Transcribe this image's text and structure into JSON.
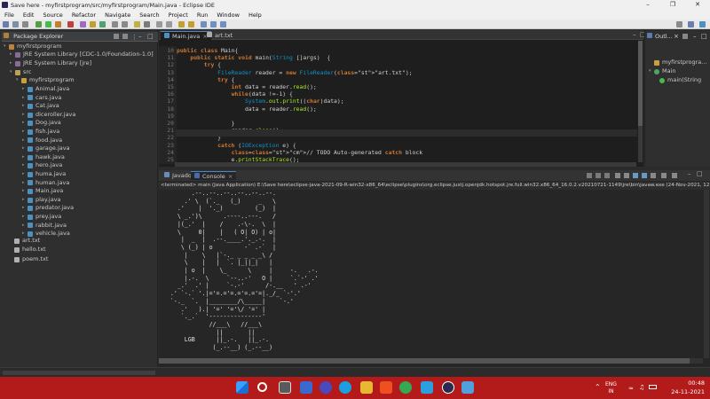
{
  "window": {
    "title": "Save here - myfirstprogram/src/myfirstprogram/Main.java - Eclipse IDE"
  },
  "menu": [
    "File",
    "Edit",
    "Source",
    "Refactor",
    "Navigate",
    "Search",
    "Project",
    "Run",
    "Window",
    "Help"
  ],
  "package_explorer": {
    "tab_label": "Package Explorer",
    "project": "myfirstprogram",
    "libs": [
      "JRE System Library [CDC-1.0/Foundation-1.0]",
      "JRE System Library [jre]"
    ],
    "src": "src",
    "package": "myfirstprogram",
    "files": [
      "Animal.java",
      "cars.java",
      "Cat.java",
      "diceroller.java",
      "Dog.java",
      "fish.java",
      "food.java",
      "garage.java",
      "hawk.java",
      "hero.java",
      "huma.java",
      "human.java",
      "Main.java",
      "play.java",
      "predator.java",
      "prey.java",
      "rabbit.java",
      "vehicle.java"
    ],
    "root_files": [
      "art.txt",
      "hello.txt",
      "poem.txt"
    ]
  },
  "editor": {
    "tabs": [
      "Main.java",
      "art.txt"
    ],
    "line_numbers": [
      "10",
      "11",
      "12",
      "13",
      "14",
      "15",
      "16",
      "17",
      "18",
      "19",
      "20",
      "21",
      "22",
      "23",
      "24",
      "25"
    ],
    "lines": [
      "public class Main{",
      "    public static void main(String []args)  {",
      "        try {",
      "            FileReader reader = new FileReader(\"art.txt\");",
      "            try {",
      "                int data = reader.read();",
      "                while(data !=-1) {",
      "                    System.out.print((char)data);",
      "                    data = reader.read();",
      "",
      "                }",
      "                reader.close();",
      "            }",
      "            catch (IOException e) {",
      "                // TODO Auto-generated catch block",
      "                e.printStackTrace();"
    ]
  },
  "outline": {
    "tab_label": "Outl...",
    "items": [
      "myfirstprogra...",
      "Main",
      "main(String"
    ]
  },
  "console": {
    "tabs": [
      "Javadoc",
      "Console"
    ],
    "terminated": "<terminated> main (Java Application) E:\\Save here\\eclipse-java-2021-09-R-win32-x86_64\\eclipse\\plugins\\org.eclipse.justj.openjdk.hotspot.jre.full.win32.x86_64_16.0.2.v20210721-1149\\jre\\bin\\javaw.exe  (24-Nov-2021, 12:",
    "ascii_art": [
      "         .--..--..--..--..--..--.",
      "       .' \\  (`._   (_)     _   \\",
      "     .'    |  '._)         (_)  |",
      "     \\ _.')\\      .----..---.   /",
      "     |(_.'  |    /    .-\\-.  \\  |",
      "     \\     0|    |   ( O| O) | o|",
      "      |  _  |  .--.____.'._.-.  |",
      "      \\ (_) | o         -` .-`  |",
      "       |    \\   |`-._ _ _ _ _\\ /",
      "       \\    |   |  `. |_||_|   |",
      "       | o  |    \\_      \\     |     -.   .-.",
      "       |.-.  \\     `--..-'   O |     `.`-' .'",
      "     _.'  .' |     `-.-'      /-.__   ' .-'",
      "   .' `-.` '.|='=.='=.='=.='=|._/_ `-'.'",
      "   `-._  `.  |________/\\_____|    `-.'",
      "      .'   ).| '=' '='\\/ '=' |",
      "      `._.`  '---------------'",
      "              //___\\   //___\\",
      "                ||       ||",
      "       LGB      ||_.-.   ||_.-.",
      "               (_.--__) (_.--__)"
    ]
  },
  "taskbar": {
    "lang_primary": "ENG",
    "lang_secondary": "IN",
    "time": "00:48",
    "date": "24-11-2021"
  }
}
